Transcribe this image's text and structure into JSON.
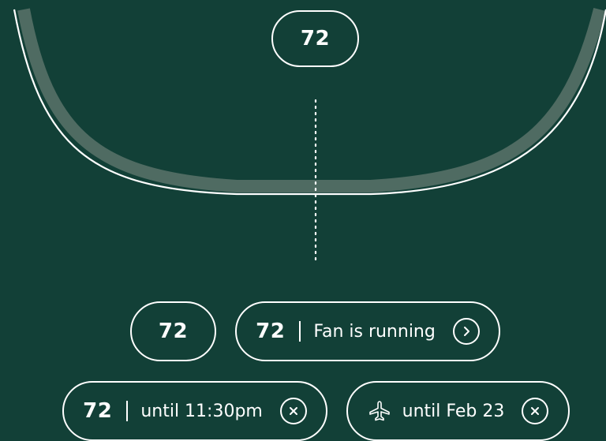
{
  "thermostat": {
    "dial_temperature": "72",
    "colors": {
      "background": "#124037",
      "foreground": "#ffffff",
      "track": "#4f6b62"
    }
  },
  "status_pills": [
    {
      "temperature": "72",
      "label": "",
      "action_icon": "none"
    },
    {
      "temperature": "72",
      "label": "Fan is running",
      "action_icon": "chevron-right-icon"
    },
    {
      "temperature": "72",
      "label": "until 11:30pm",
      "action_icon": "close-icon"
    },
    {
      "temperature": "",
      "leading_icon": "airplane-icon",
      "label": "until Feb 23",
      "action_icon": "close-icon"
    }
  ]
}
